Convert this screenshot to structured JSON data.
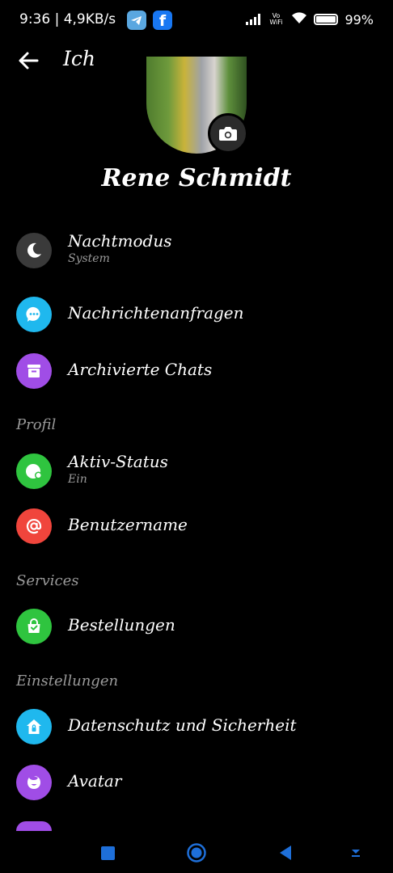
{
  "status_bar": {
    "time_speed": "9:36 | 4,9KB/s",
    "network_label": "Vo WiFi",
    "battery": "99%",
    "notif_apps": [
      "telegram-icon",
      "facebook-icon"
    ],
    "fb_letter": "f"
  },
  "header": {
    "title": "Ich"
  },
  "profile": {
    "name": "Rene Schmidt"
  },
  "menu": {
    "night_mode": {
      "label": "Nachtmodus",
      "sub": "System",
      "icon": "moon-icon",
      "color": "#3a3a3a"
    },
    "message_requests": {
      "label": "Nachrichtenanfragen",
      "icon": "chat-bubble-icon",
      "color": "#1fb8ee"
    },
    "archived_chats": {
      "label": "Archivierte Chats",
      "icon": "archive-box-icon",
      "color": "#a04de6"
    }
  },
  "sections": {
    "profile": "Profil",
    "services": "Services",
    "settings": "Einstellungen"
  },
  "profile_items": {
    "active_status": {
      "label": "Aktiv-Status",
      "sub": "Ein",
      "icon": "active-status-icon",
      "color": "#2fc43f"
    },
    "username": {
      "label": "Benutzername",
      "icon": "at-sign-icon",
      "color": "#f0453c"
    }
  },
  "services_items": {
    "orders": {
      "label": "Bestellungen",
      "icon": "shopping-bag-icon",
      "color": "#2fc43f"
    }
  },
  "settings_items": {
    "privacy": {
      "label": "Datenschutz und Sicherheit",
      "icon": "shield-home-icon",
      "color": "#1fb8ee"
    },
    "avatar": {
      "label": "Avatar",
      "icon": "avatar-face-icon",
      "color": "#a04de6"
    }
  },
  "colors": {
    "background": "#000000",
    "text": "#ffffff",
    "secondary_text": "#9a9a9a",
    "nav_accent": "#1e6fd9"
  }
}
